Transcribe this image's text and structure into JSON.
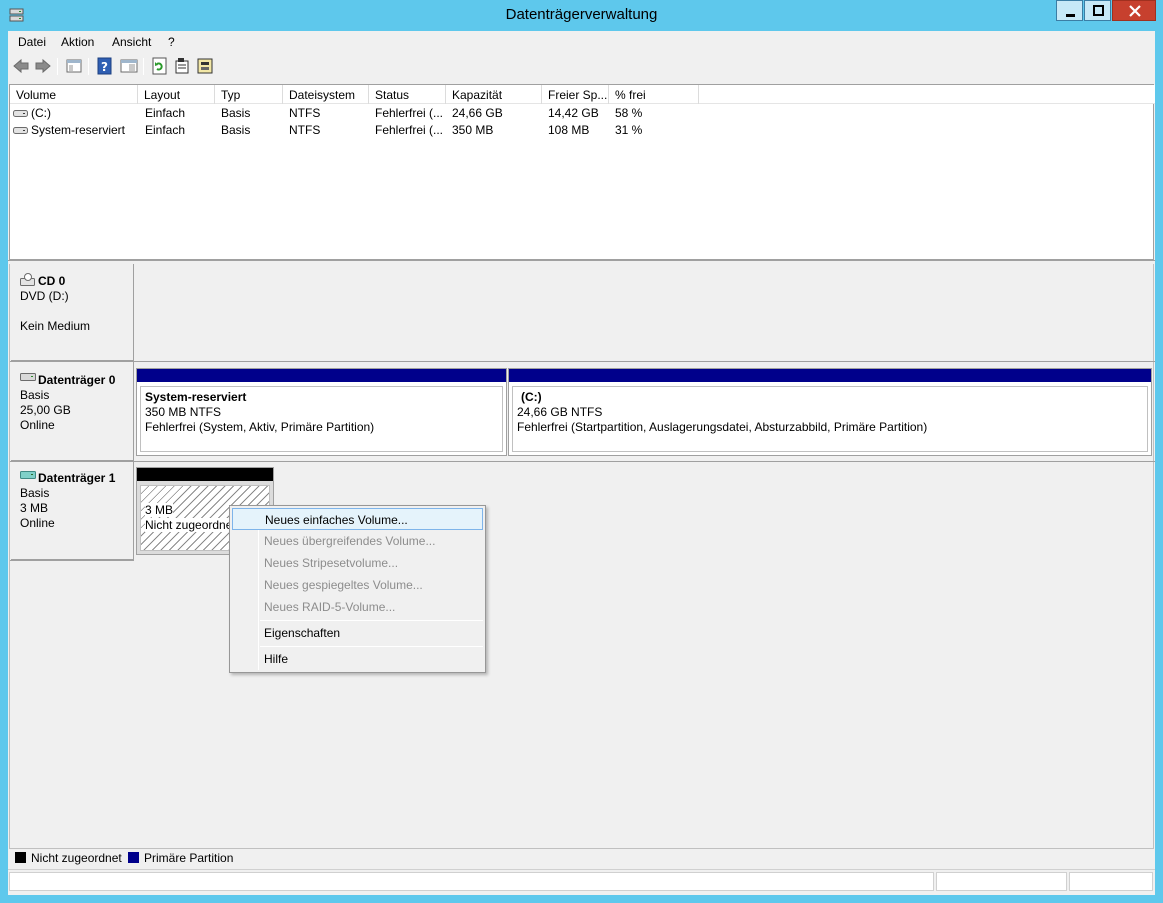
{
  "window": {
    "title": "Datenträgerverwaltung"
  },
  "menu": [
    "Datei",
    "Aktion",
    "Ansicht",
    "?"
  ],
  "toolbar": [
    "back-icon",
    "forward-icon",
    "console-tree-icon",
    "help-icon",
    "properties-view-icon",
    "refresh-icon",
    "properties-icon",
    "rescan-icon"
  ],
  "volume_list": {
    "columns": [
      "Volume",
      "Layout",
      "Typ",
      "Dateisystem",
      "Status",
      "Kapazität",
      "Freier Sp...",
      "% frei"
    ],
    "rows": [
      [
        "(C:)",
        "Einfach",
        "Basis",
        "NTFS",
        "Fehlerfrei (...",
        "24,66 GB",
        "14,42 GB",
        "58 %"
      ],
      [
        "System-reserviert",
        "Einfach",
        "Basis",
        "NTFS",
        "Fehlerfrei (...",
        "350 MB",
        "108 MB",
        "31 %"
      ]
    ]
  },
  "disks": [
    {
      "name": "CD 0",
      "line1": "DVD (D:)",
      "line2": "",
      "line3": "Kein Medium"
    },
    {
      "name": "Datenträger 0",
      "line1": "Basis",
      "line2": "25,00 GB",
      "line3": "Online",
      "partitions": [
        {
          "name": "System-reserviert",
          "size": "350 MB NTFS",
          "status": "Fehlerfrei (System, Aktiv, Primäre Partition)"
        },
        {
          "name": "(C:)",
          "size": "24,66 GB NTFS",
          "status": "Fehlerfrei (Startpartition, Auslagerungsdatei, Absturzabbild, Primäre Partition)"
        }
      ]
    },
    {
      "name": "Datenträger 1",
      "line1": "Basis",
      "line2": "3 MB",
      "line3": "Online",
      "partitions": [
        {
          "size": "3 MB",
          "status": "Nicht zugeordnet"
        }
      ]
    }
  ],
  "context_menu": [
    {
      "label": "Neues einfaches Volume...",
      "enabled": true
    },
    {
      "label": "Neues übergreifendes Volume...",
      "enabled": false
    },
    {
      "label": "Neues Stripesetvolume...",
      "enabled": false
    },
    {
      "label": "Neues gespiegeltes Volume...",
      "enabled": false
    },
    {
      "label": "Neues RAID-5-Volume...",
      "enabled": false
    },
    {
      "label": "Eigenschaften",
      "enabled": true
    },
    {
      "label": "Hilfe",
      "enabled": true
    }
  ],
  "legend": [
    {
      "label": "Nicht zugeordnet",
      "color": "#000000"
    },
    {
      "label": "Primäre Partition",
      "color": "#00008b"
    }
  ],
  "colors": {
    "titlebar": "#5ec8ec",
    "primary_partition": "#00008b",
    "unallocated": "#000000",
    "menu_highlight": "#e5f3fb"
  }
}
